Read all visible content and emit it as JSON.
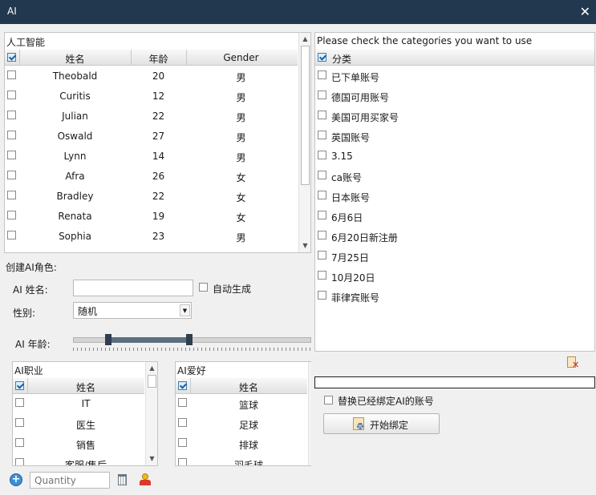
{
  "window": {
    "title": "AI"
  },
  "left_table": {
    "caption": "人工智能",
    "headers": [
      "姓名",
      "年龄",
      "Gender"
    ],
    "rows": [
      {
        "name": "Theobald",
        "age": "20",
        "gender": "男"
      },
      {
        "name": "Curitis",
        "age": "12",
        "gender": "男"
      },
      {
        "name": "Julian",
        "age": "22",
        "gender": "男"
      },
      {
        "name": "Oswald",
        "age": "27",
        "gender": "男"
      },
      {
        "name": "Lynn",
        "age": "14",
        "gender": "男"
      },
      {
        "name": "Afra",
        "age": "26",
        "gender": "女"
      },
      {
        "name": "Bradley",
        "age": "22",
        "gender": "女"
      },
      {
        "name": "Renata",
        "age": "19",
        "gender": "女"
      },
      {
        "name": "Sophia",
        "age": "23",
        "gender": "男"
      }
    ]
  },
  "create": {
    "section_title": "创建AI角色:",
    "name_label": "AI 姓名:",
    "name_value": "",
    "auto_label": "自动生成",
    "gender_label": "性别:",
    "gender_value": "随机",
    "age_label": "AI 年龄:"
  },
  "job_list": {
    "caption": "AI职业",
    "header": "姓名",
    "items": [
      "IT",
      "医生",
      "销售",
      "客服/售后"
    ]
  },
  "hobby_list": {
    "caption": "AI爱好",
    "header": "姓名",
    "items": [
      "篮球",
      "足球",
      "排球",
      "羽毛球"
    ]
  },
  "bottom": {
    "quantity_placeholder": "Quantity"
  },
  "categories": {
    "caption": "Please check the categories you want to use",
    "header": "分类",
    "items": [
      "已下单账号",
      "德国可用账号",
      "美国可用买家号",
      "英国账号",
      "3.15",
      "ca账号",
      "日本账号",
      "6月6日",
      "6月20日新注册",
      "7月25日",
      "10月20日",
      "菲律宾账号"
    ]
  },
  "right_bottom": {
    "replace_label": "替换已经绑定AI的账号",
    "start_button": "开始绑定"
  },
  "colors": {
    "titlebar": "#21384f",
    "accent": "#3c7fb1",
    "slider": "#5b6f80"
  }
}
